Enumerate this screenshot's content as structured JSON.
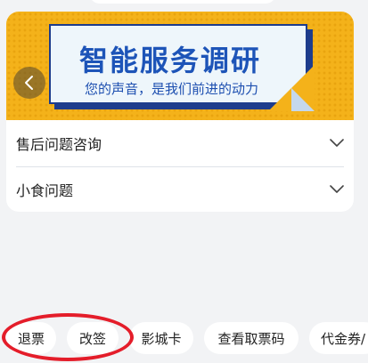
{
  "banner": {
    "title": "智能服务调研",
    "subtitle": "您的声音，是我们前进的动力",
    "prev_icon": "chevron-left-icon"
  },
  "faq": [
    {
      "label": "售后问题咨询",
      "icon": "chevron-down-icon"
    },
    {
      "label": "小食问题",
      "icon": "chevron-down-icon"
    }
  ],
  "quick_tags": [
    {
      "label": "退票"
    },
    {
      "label": "改签"
    },
    {
      "label": "影城卡"
    },
    {
      "label": "查看取票码"
    },
    {
      "label": "代金券/"
    }
  ],
  "colors": {
    "banner_bg": "#f4b21a",
    "poster_text": "#1d54b8",
    "highlight": "#e41d2a",
    "page_bg": "#f2f3f5"
  }
}
